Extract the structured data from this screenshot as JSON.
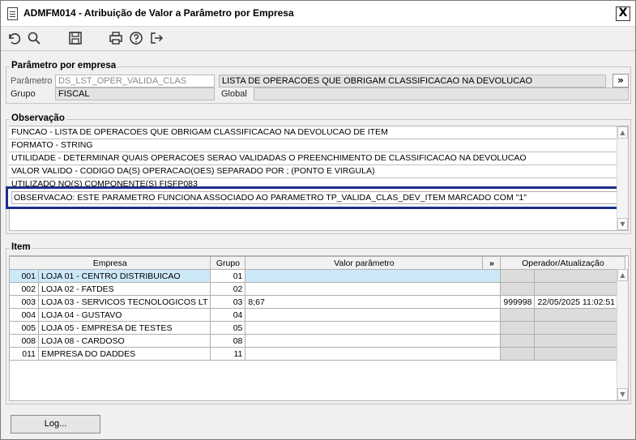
{
  "window": {
    "title": "ADMFM014 - Atribuição de Valor a Parâmetro por Empresa",
    "close_label": "X"
  },
  "toolbar": {
    "icons": [
      "undo-icon",
      "search-icon",
      "save-icon",
      "print-icon",
      "help-icon",
      "exit-icon"
    ]
  },
  "parametro_group": {
    "title": "Parâmetro por empresa",
    "parametro_label": "Parâmetro",
    "parametro_value": "DS_LST_OPER_VALIDA_CLAS",
    "descricao_value": "LISTA DE OPERACOES QUE OBRIGAM CLASSIFICACAO NA DEVOLUCAO",
    "expand_label": "»",
    "grupo_label": "Grupo",
    "grupo_value": "FISCAL",
    "global_label": "Global",
    "global_value": ""
  },
  "observacao": {
    "title": "Observação",
    "lines": [
      "FUNCAO - LISTA DE OPERACOES QUE OBRIGAM CLASSIFICACAO NA DEVOLUCAO DE ITEM",
      "FORMATO - STRING",
      "UTILIDADE - DETERMINAR QUAIS OPERACOES SERAO VALIDADAS O PREENCHIMENTO DE CLASSIFICACAO NA DEVOLUCAO",
      "VALOR VALIDO - CODIGO DA(S) OPERACAO(OES) SEPARADO POR ; (PONTO E VIRGULA)",
      "UTILIZADO NO(S) COMPONENTE(S) FISFP083",
      "OBSERVACAO: ESTE PARAMETRO FUNCIONA ASSOCIADO AO PARAMETRO TP_VALIDA_CLAS_DEV_ITEM MARCADO COM \"1\""
    ]
  },
  "item": {
    "title": "Item",
    "columns": {
      "empresa": "Empresa",
      "grupo": "Grupo",
      "valor": "Valor parâmetro",
      "expand": "»",
      "operador": "Operador/Atualização"
    },
    "rows": [
      {
        "cod": "001",
        "nome": "LOJA 01 - CENTRO DISTRIBUICAO",
        "grupo": "01",
        "valor": "",
        "operador": "",
        "data": ""
      },
      {
        "cod": "002",
        "nome": "LOJA 02 - FATDES",
        "grupo": "02",
        "valor": "",
        "operador": "",
        "data": ""
      },
      {
        "cod": "003",
        "nome": "LOJA 03 - SERVICOS TECNOLOGICOS LT",
        "grupo": "03",
        "valor": "8;67",
        "operador": "999998",
        "data": "22/05/2025 11:02:51"
      },
      {
        "cod": "004",
        "nome": "LOJA 04 - GUSTAVO",
        "grupo": "04",
        "valor": "",
        "operador": "",
        "data": ""
      },
      {
        "cod": "005",
        "nome": "LOJA 05 - EMPRESA DE TESTES",
        "grupo": "05",
        "valor": "",
        "operador": "",
        "data": ""
      },
      {
        "cod": "008",
        "nome": "LOJA 08 - CARDOSO",
        "grupo": "08",
        "valor": "",
        "operador": "",
        "data": ""
      },
      {
        "cod": "011",
        "nome": "EMPRESA DO DADDES",
        "grupo": "11",
        "valor": "",
        "operador": "",
        "data": ""
      }
    ]
  },
  "footer": {
    "log_label": "Log..."
  }
}
